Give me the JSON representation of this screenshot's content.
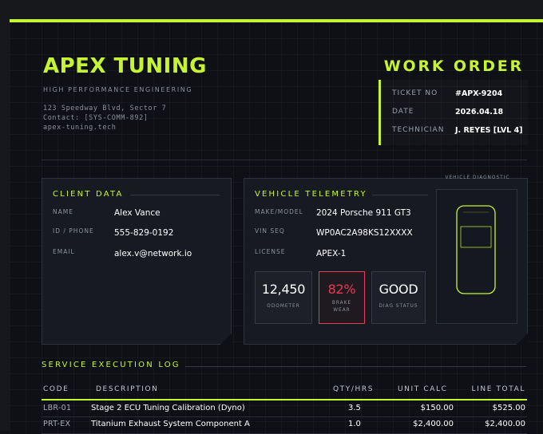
{
  "brand": {
    "name": "APEX TUNING",
    "tagline": "HIGH PERFORMANCE ENGINEERING",
    "address": "123 Speedway Blvd, Sector 7",
    "contact": "Contact: [SYS-COMM-892]",
    "website": "apex-tuning.tech"
  },
  "doc": {
    "title": "WORK ORDER",
    "ticket": [
      {
        "label": "TICKET NO",
        "value": "#APX-9204"
      },
      {
        "label": "DATE",
        "value": "2026.04.18"
      },
      {
        "label": "TECHNICIAN",
        "value": "J. REYES [LVL 4]"
      }
    ]
  },
  "client": {
    "heading": "CLIENT DATA",
    "fields": [
      {
        "label": "NAME",
        "value": "Alex Vance"
      },
      {
        "label": "ID / PHONE",
        "value": "555-829-0192"
      },
      {
        "label": "EMAIL",
        "value": "alex.v@network.io"
      }
    ]
  },
  "vehicle": {
    "heading": "VEHICLE TELEMETRY",
    "fields": [
      {
        "label": "MAKE/MODEL",
        "value": "2024 Porsche 911 GT3"
      },
      {
        "label": "VIN SEQ",
        "value": "WP0AC2A98KS12XXXX"
      },
      {
        "label": "LICENSE",
        "value": "APEX-1"
      }
    ],
    "stats": [
      {
        "value": "12,450",
        "label": "ODOMETER"
      },
      {
        "value": "82%",
        "label": "BRAKE WEAR",
        "label_line1": "BRAKE",
        "label_line2": "WEAR"
      },
      {
        "value": "GOOD",
        "label": "DIAG STATUS"
      }
    ],
    "diagnostic_label": "VEHICLE DIAGNOSTIC"
  },
  "service_log": {
    "heading": "SERVICE EXECUTION LOG",
    "columns": [
      "CODE",
      "DESCRIPTION",
      "QTY/HRS",
      "UNIT CALC",
      "LINE TOTAL"
    ],
    "rows": [
      {
        "code": "LBR-01",
        "description": "Stage 2 ECU Tuning Calibration (Dyno)",
        "qty": "3.5",
        "unit": "$150.00",
        "total": "$525.00"
      },
      {
        "code": "PRT-EX",
        "description": "Titanium Exhaust System Component A",
        "qty": "1.0",
        "unit": "$2,400.00",
        "total": "$2,400.00"
      }
    ]
  },
  "colors": {
    "accent": "#c6f432",
    "alert": "#e83a55",
    "background": "#0e1015",
    "panel": "#171a21"
  }
}
